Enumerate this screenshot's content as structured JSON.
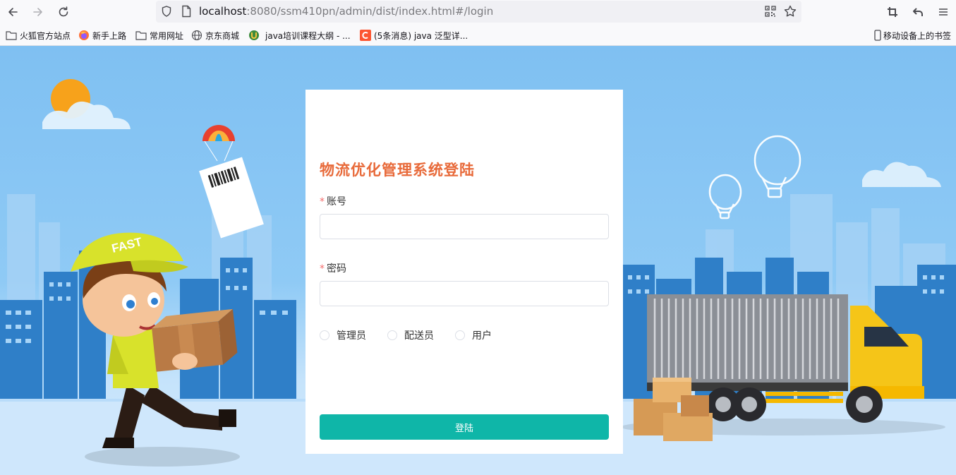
{
  "browser": {
    "url_host": "localhost",
    "url_rest": ":8080/ssm410pn/admin/dist/index.html#/login",
    "bookmarks": [
      {
        "label": "火狐官方站点",
        "icon": "folder-icon"
      },
      {
        "label": "新手上路",
        "icon": "firefox-icon"
      },
      {
        "label": "常用网址",
        "icon": "folder-icon"
      },
      {
        "label": "京东商城",
        "icon": "globe-icon"
      },
      {
        "label": "java培训课程大纲 - ...",
        "icon": "site-icon"
      },
      {
        "label": "(5条消息) java 泛型详...",
        "icon": "csdn-icon"
      }
    ],
    "mobile_bookmarks": "移动设备上的书签"
  },
  "login": {
    "title": "物流优化管理系统登陆",
    "required_mark": "*",
    "account_label": "账号",
    "account_value": "",
    "password_label": "密码",
    "password_value": "",
    "roles": [
      "管理员",
      "配送员",
      "用户"
    ],
    "submit_label": "登陆"
  },
  "colors": {
    "title": "#e86a3a",
    "button": "#0fb6a8",
    "sky": "#8fcaf5"
  }
}
